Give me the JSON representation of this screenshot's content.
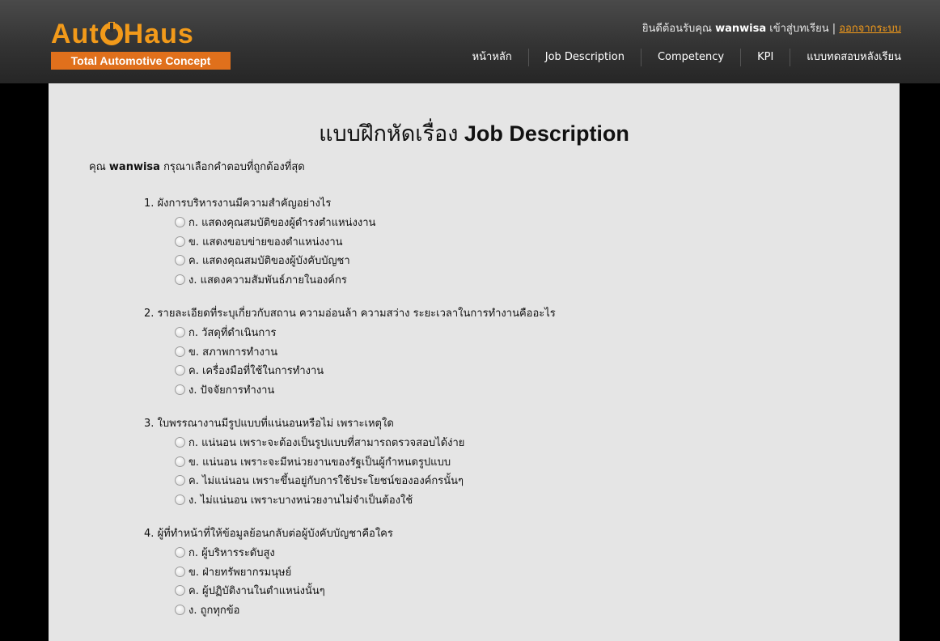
{
  "header": {
    "logo": {
      "main_prefix": "Aut",
      "main_suffix": "Haus",
      "tagline": "Total Automotive Concept"
    },
    "welcome_prefix": "ยินดีต้อนรับคุณ",
    "username": "wanwisa",
    "welcome_suffix": "เข้าสู่บทเรียน |",
    "logout_label": "ออกจากระบบ",
    "nav": [
      {
        "label": "หน้าหลัก"
      },
      {
        "label": "Job Description"
      },
      {
        "label": "Competency"
      },
      {
        "label": "KPI"
      },
      {
        "label": "แบบทดสอบหลังเรียน"
      }
    ],
    "colors": {
      "brand_orange": "#f29a1a",
      "tagline_bg": "#e0701c"
    }
  },
  "page": {
    "title_thai": "แบบฝึกหัดเรื่อง",
    "title_latin": "Job Description",
    "intro_prefix": "คุณ",
    "intro_user": "wanwisa",
    "intro_suffix": "กรุณาเลือกคำตอบที่ถูกต้องที่สุด"
  },
  "questions": [
    {
      "text": "1. ผังการบริหารงานมีความสำคัญอย่างไร",
      "options": [
        "ก. แสดงคุณสมบัติของผู้ดำรงตำแหน่งงาน",
        "ข. แสดงขอบข่ายของตำแหน่งงาน",
        "ค. แสดงคุณสมบัติของผู้บังคับบัญชา",
        "ง. แสดงความสัมพันธ์ภายในองค์กร"
      ]
    },
    {
      "text": "2. รายละเอียดที่ระบุเกี่ยวกับสถาน ความอ่อนล้า ความสว่าง ระยะเวลาในการทำงานคืออะไร",
      "options": [
        "ก. วัสดุที่ดำเนินการ",
        "ข. สภาพการทำงาน",
        "ค. เครื่องมือที่ใช้ในการทำงาน",
        "ง. ปัจจัยการทำงาน"
      ]
    },
    {
      "text": "3. ใบพรรณางานมีรูปแบบที่แน่นอนหรือไม่ เพราะเหตุใด",
      "options": [
        "ก. แน่นอน เพราะจะต้องเป็นรูปแบบที่สามารถตรวจสอบได้ง่าย",
        "ข. แน่นอน เพราะจะมีหน่วยงานของรัฐเป็นผู้กำหนดรูปแบบ",
        "ค. ไม่แน่นอน เพราะขึ้นอยู่กับการใช้ประโยชน์ขององค์กรนั้นๆ",
        "ง. ไม่แน่นอน เพราะบางหน่วยงานไม่จำเป็นต้องใช้"
      ]
    },
    {
      "text": "4. ผู้ที่ทำหน้าที่ให้ข้อมูลย้อนกลับต่อผู้บังคับบัญชาคือใคร",
      "options": [
        "ก. ผู้บริหารระดับสูง",
        "ข. ฝ่ายทรัพยากรมนุษย์",
        "ค. ผู้ปฏิบัติงานในตำแหน่งนั้นๆ",
        "ง. ถูกทุกข้อ"
      ]
    }
  ]
}
